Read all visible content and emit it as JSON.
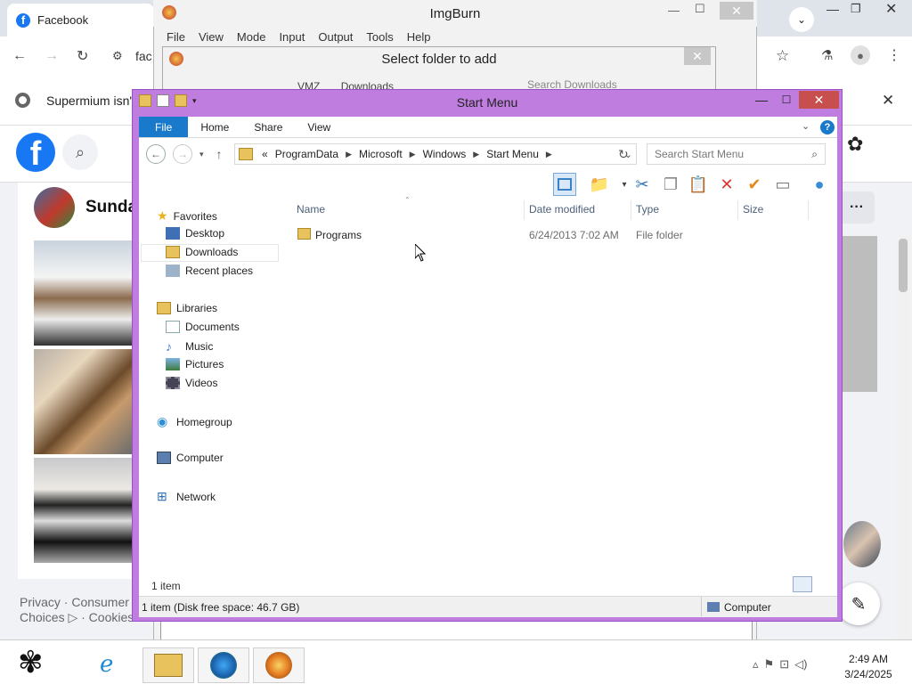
{
  "browser": {
    "tab_title": "Facebook",
    "address_partial": "fac",
    "infobar_text": "Supermium isn't",
    "profile_name": "Sunda",
    "footer_line1": "Privacy · Consumer",
    "footer_line2": "Choices ▷ · Cookies"
  },
  "imgburn": {
    "title": "ImgBurn",
    "menu": [
      "File",
      "View",
      "Mode",
      "Input",
      "Output",
      "Tools",
      "Help"
    ],
    "dialog_title": "Select folder to add",
    "dialog_path": [
      "VMZ",
      "Downloads"
    ],
    "dialog_search": "Search Downloads"
  },
  "explorer": {
    "title": "Start Menu",
    "ribbon_tabs": [
      "File",
      "Home",
      "Share",
      "View"
    ],
    "breadcrumb": [
      "ProgramData",
      "Microsoft",
      "Windows",
      "Start Menu"
    ],
    "breadcrumb_overflow": "«",
    "search_placeholder": "Search Start Menu",
    "nav": {
      "favorites": "Favorites",
      "favorites_items": [
        "Desktop",
        "Downloads",
        "Recent places"
      ],
      "libraries": "Libraries",
      "libraries_items": [
        "Documents",
        "Music",
        "Pictures",
        "Videos"
      ],
      "homegroup": "Homegroup",
      "computer": "Computer",
      "network": "Network"
    },
    "columns": {
      "name": "Name",
      "date": "Date modified",
      "type": "Type",
      "size": "Size"
    },
    "files": [
      {
        "name": "Programs",
        "date": "6/24/2013 7:02 AM",
        "type": "File folder",
        "size": ""
      }
    ],
    "item_count": "1 item",
    "status": "1 item (Disk free space: 46.7 GB)",
    "status_right": "Computer"
  },
  "taskbar": {
    "time": "2:49 AM",
    "date": "3/24/2025"
  },
  "colors": {
    "explorer_frame": "#c07de0",
    "ribbon_file": "#1979ca",
    "close_red": "#c7504f",
    "facebook_blue": "#1877f2"
  }
}
